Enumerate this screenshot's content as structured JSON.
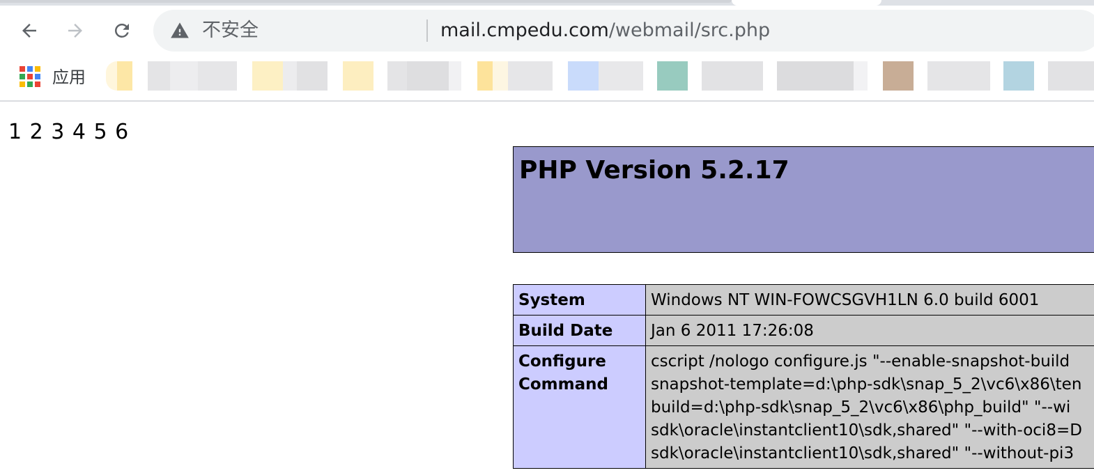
{
  "browser": {
    "security_label": "不安全",
    "url_host": "mail.cmpedu.com",
    "url_path": "/webmail/src.php",
    "bookmarks_apps_label": "应用"
  },
  "page": {
    "pager": "1 2 3 4 5 6",
    "php_title": "PHP Version 5.2.17",
    "rows": [
      {
        "key": "System",
        "value": "Windows NT WIN-FOWCSGVH1LN 6.0 build 6001"
      },
      {
        "key": "Build Date",
        "value": "Jan 6 2011 17:26:08"
      },
      {
        "key": "Configure Command",
        "lines": [
          "cscript /nologo configure.js \"--enable-snapshot-build",
          "snapshot-template=d:\\php-sdk\\snap_5_2\\vc6\\x86\\ten",
          "build=d:\\php-sdk\\snap_5_2\\vc6\\x86\\php_build\" \"--wi",
          "sdk\\oracle\\instantclient10\\sdk,shared\" \"--with-oci8=D",
          "sdk\\oracle\\instantclient10\\sdk,shared\" \"--without-pi3"
        ]
      }
    ]
  },
  "colors": {
    "php_header_bg": "#9999cc",
    "php_key_bg": "#ccccff",
    "php_value_bg": "#cccccc"
  }
}
